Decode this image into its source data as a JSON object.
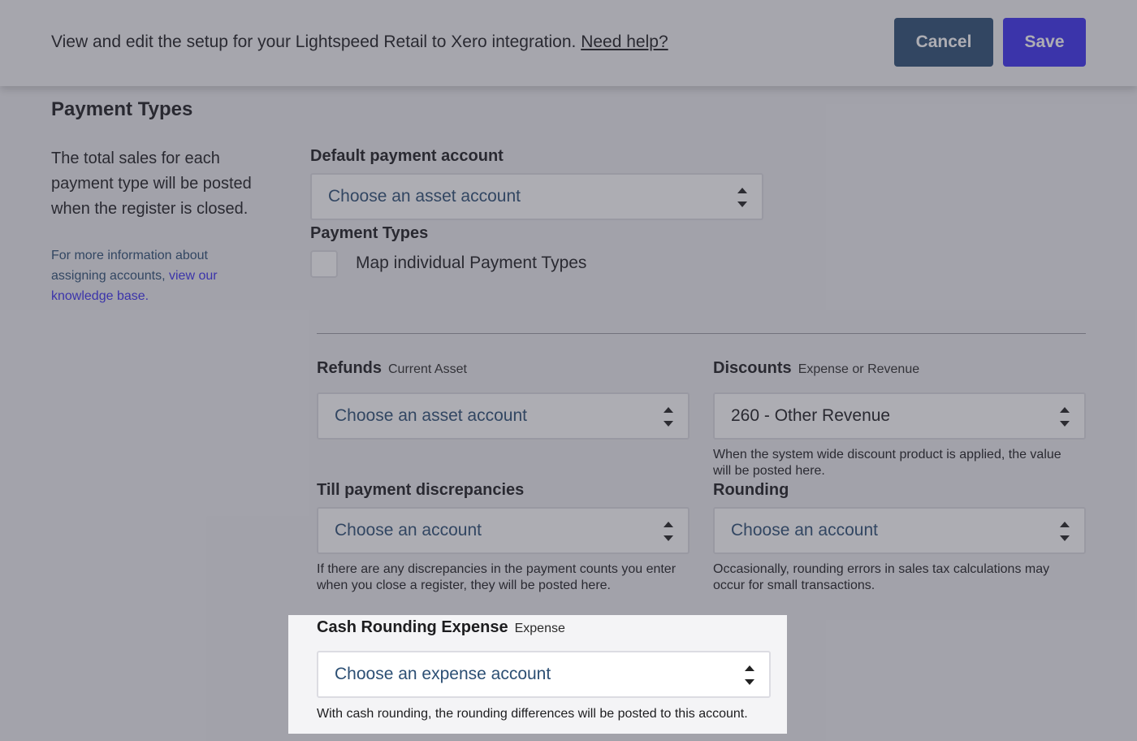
{
  "header": {
    "description": "View and edit the setup for your Lightspeed Retail to Xero integration.",
    "help_link": "Need help?",
    "cancel_label": "Cancel",
    "save_label": "Save"
  },
  "section": {
    "title": "Payment Types",
    "description": "The total sales for each payment type will be posted when the register is closed.",
    "info_prefix": "For more information about assigning accounts,",
    "info_link": "view our knowledge base."
  },
  "default_payment": {
    "label": "Default payment account",
    "value": "Choose an asset account"
  },
  "payment_types": {
    "label": "Payment Types",
    "checkbox_label": "Map individual Payment Types",
    "checked": false
  },
  "refunds": {
    "label": "Refunds",
    "sublabel": "Current Asset",
    "value": "Choose an asset account"
  },
  "discounts": {
    "label": "Discounts",
    "sublabel": "Expense or Revenue",
    "value": "260 - Other Revenue",
    "help": "When the system wide discount product is applied, the value will be posted here."
  },
  "till": {
    "label": "Till payment discrepancies",
    "value": "Choose an account",
    "help": "If there are any discrepancies in the payment counts you enter when you close a register, they will be posted here."
  },
  "rounding": {
    "label": "Rounding",
    "value": "Choose an account",
    "help": "Occasionally, rounding errors in sales tax calculations may occur for small transactions."
  },
  "cash_rounding": {
    "label": "Cash Rounding Expense",
    "sublabel": "Expense",
    "value": "Choose an expense account",
    "help": "With cash rounding, the rounding differences will be posted to this account."
  }
}
